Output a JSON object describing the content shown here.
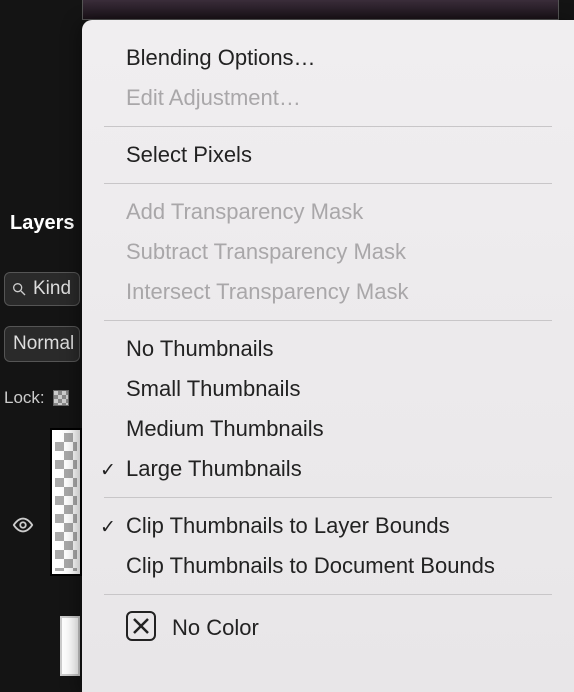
{
  "panel": {
    "tab": "Layers",
    "kind_label": "Kind",
    "blend_mode": "Normal",
    "lock_label": "Lock:"
  },
  "menu": {
    "blending_options": "Blending Options…",
    "edit_adjustment": "Edit Adjustment…",
    "select_pixels": "Select Pixels",
    "add_mask": "Add Transparency Mask",
    "subtract_mask": "Subtract Transparency Mask",
    "intersect_mask": "Intersect Transparency Mask",
    "no_thumbs": "No Thumbnails",
    "small_thumbs": "Small Thumbnails",
    "medium_thumbs": "Medium Thumbnails",
    "large_thumbs": "Large Thumbnails",
    "clip_layer": "Clip Thumbnails to Layer Bounds",
    "clip_doc": "Clip Thumbnails to Document Bounds",
    "no_color": "No Color",
    "check": "✓"
  }
}
